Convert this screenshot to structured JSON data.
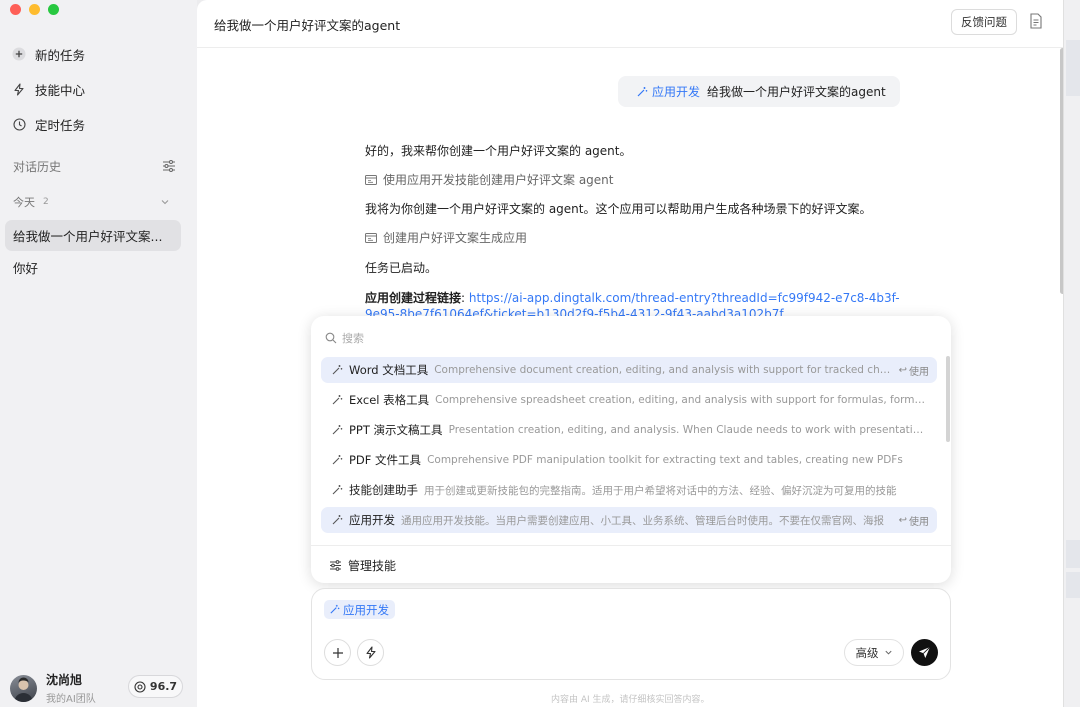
{
  "sidebar": {
    "nav": [
      {
        "label": "新的任务",
        "icon": "plus-circle-icon"
      },
      {
        "label": "技能中心",
        "icon": "lightning-icon"
      },
      {
        "label": "定时任务",
        "icon": "clock-icon"
      }
    ],
    "history_label": "对话历史",
    "today_label": "今天",
    "today_count": "2",
    "conversations": [
      "给我做一个用户好评文案...",
      "你好"
    ],
    "user": {
      "name": "沈尚旭",
      "team": "我的AI团队",
      "credits": "96.7"
    }
  },
  "header": {
    "title": "给我做一个用户好评文案的agent",
    "feedback_label": "反馈问题"
  },
  "chat": {
    "user_message": {
      "tag": "应用开发",
      "text": "给我做一个用户好评文案的agent"
    },
    "answer": {
      "line1": "好的，我来帮你创建一个用户好评文案的 agent。",
      "step1": "使用应用开发技能创建用户好评文案 agent",
      "line2": "我将为你创建一个用户好评文案的 agent。这个应用可以帮助用户生成各种场景下的好评文案。",
      "step2": "创建用户好评文案生成应用",
      "line3": "任务已启动。",
      "link_label": "应用创建过程链接",
      "link_colon": ":",
      "link_url_1": "https://ai-app.dingtalk.com/thread-entry?threadId=fc99f942-e7c8-4b3f-",
      "link_url_2": "9e95-8be7f61064ef&ticket=b130d2f9-f5b4-4312-9f43-aabd3a102b7f"
    }
  },
  "skills_popup": {
    "search_placeholder": "搜索",
    "use_label": "使用",
    "items": [
      {
        "name": "Word 文档工具",
        "desc": "Comprehensive document creation, editing, and analysis with support for tracked changes, comments, formatting",
        "highlighted": true,
        "show_use": true
      },
      {
        "name": "Excel 表格工具",
        "desc": "Comprehensive spreadsheet creation, editing, and analysis with support for formulas, formatting",
        "highlighted": false,
        "show_use": false
      },
      {
        "name": "PPT 演示文稿工具",
        "desc": "Presentation creation, editing, and analysis. When Claude needs to work with presentations",
        "highlighted": false,
        "show_use": false
      },
      {
        "name": "PDF 文件工具",
        "desc": "Comprehensive PDF manipulation toolkit for extracting text and tables, creating new PDFs",
        "highlighted": false,
        "show_use": false
      },
      {
        "name": "技能创建助手",
        "desc": "用于创建或更新技能包的完整指南。适用于用户希望将对话中的方法、经验、偏好沉淀为可复用的技能",
        "highlighted": false,
        "show_use": false
      },
      {
        "name": "应用开发",
        "desc": "通用应用开发技能。当用户需要创建应用、小工具、业务系统、管理后台时使用。不要在仅需官网、海报",
        "highlighted": true,
        "show_use": true
      }
    ],
    "manage_label": "管理技能"
  },
  "composer": {
    "chip": "应用开发",
    "level": "高级"
  },
  "disclaimer": "内容由 AI 生成，请仔细核实回答内容。",
  "colors": {
    "accent": "#3478f6",
    "highlight": "#e9eefb",
    "send": "#111111"
  }
}
